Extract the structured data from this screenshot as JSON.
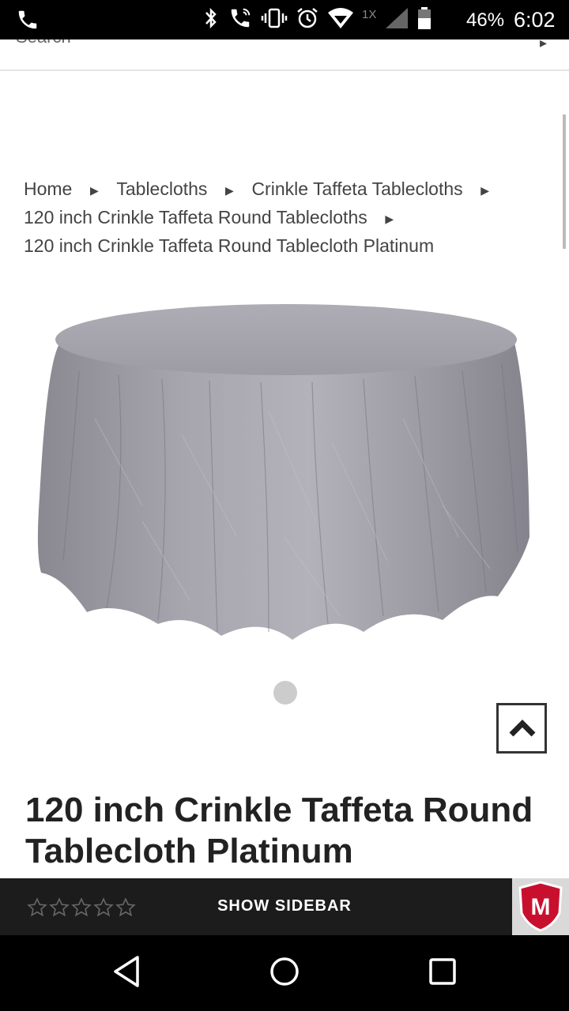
{
  "status_bar": {
    "battery_percent": "46%",
    "time": "6:02",
    "data_speed": "1X"
  },
  "search": {
    "placeholder": "Search"
  },
  "breadcrumb": {
    "items": [
      "Home",
      "Tablecloths",
      "Crinkle Taffeta Tablecloths",
      "120 inch Crinkle Taffeta Round Tablecloths",
      "120 inch Crinkle Taffeta Round Tablecloth Platinum"
    ]
  },
  "product": {
    "title": "120 inch Crinkle Taffeta Round Tablecloth Platinum",
    "image_color": "#9d9ba3",
    "rating": 0,
    "rating_max": 5
  },
  "bottom_bar": {
    "show_sidebar_label": "SHOW SIDEBAR",
    "mcafee_letter": "M"
  }
}
